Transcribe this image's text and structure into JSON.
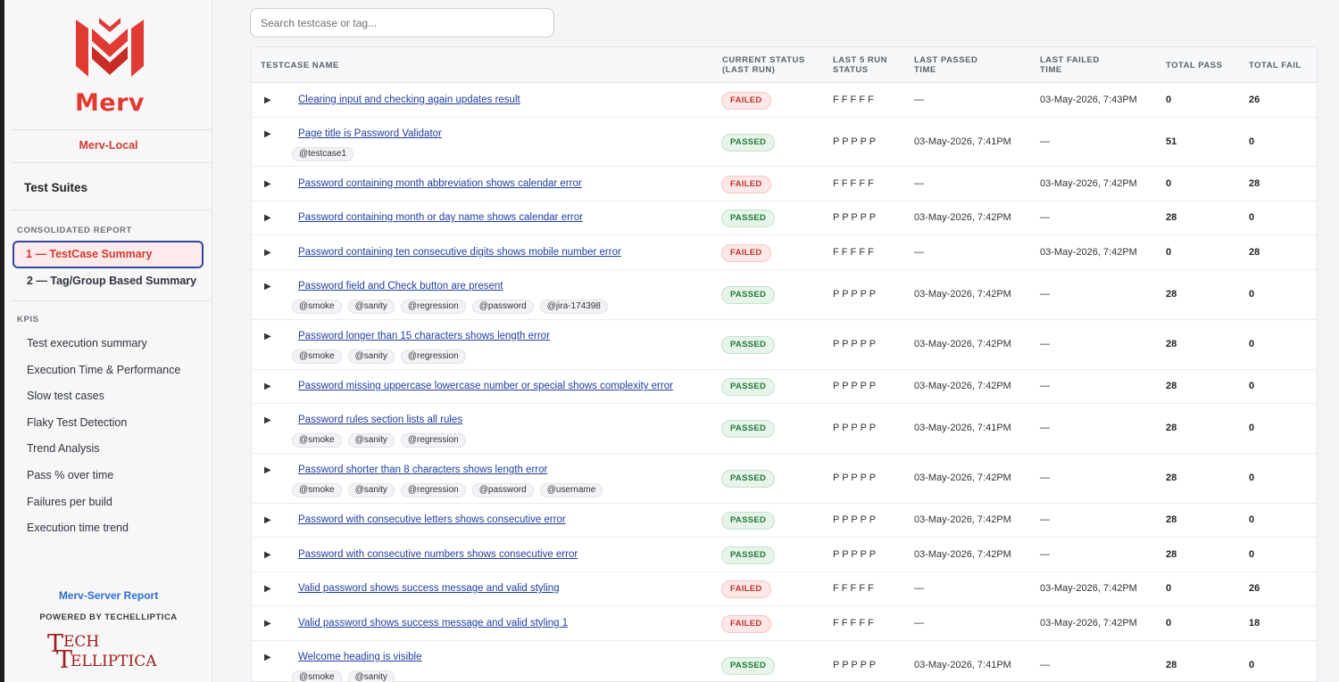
{
  "brand": {
    "logo_text": "Merv",
    "environment": "Merv-Local",
    "server_link": "Merv-Server Report",
    "powered_by": "POWERED BY TECHELLIPTICA",
    "partner_logo_line1": "ECH",
    "partner_logo_line2": "ELLIPTICA",
    "accent_color": "#e03a32"
  },
  "sidebar": {
    "suites_label": "Test Suites",
    "consolidated_label": "CONSOLIDATED REPORT",
    "consolidated_items": [
      {
        "label": "1 — TestCase Summary",
        "active": true
      },
      {
        "label": "2 — Tag/Group Based Summary",
        "active": false
      }
    ],
    "kpis_label": "KPIS",
    "kpi_items": [
      {
        "label": "Test execution summary"
      },
      {
        "label": "Execution Time & Performance"
      },
      {
        "label": "Slow test cases"
      },
      {
        "label": "Flaky Test Detection"
      },
      {
        "label": "Trend Analysis"
      },
      {
        "label": "Pass % over time"
      },
      {
        "label": "Failures per build"
      },
      {
        "label": "Execution time trend"
      }
    ]
  },
  "search": {
    "placeholder": "Search testcase or tag..."
  },
  "table": {
    "headers": {
      "name": "TESTCASE NAME",
      "status_1": "CURRENT STATUS",
      "status_2": "(LAST RUN)",
      "last5_1": "LAST 5 RUN",
      "last5_2": "STATUS",
      "passed_1": "LAST PASSED",
      "passed_2": "TIME",
      "failed_1": "LAST FAILED",
      "failed_2": "TIME",
      "total_pass": "TOTAL PASS",
      "total_fail": "TOTAL FAIL"
    },
    "rows": [
      {
        "name": "Clearing input and checking again updates result",
        "tags": [],
        "status": "FAILED",
        "last5": "F F F F F",
        "last_passed": "—",
        "last_failed": "03-May-2026, 7:43PM",
        "total_pass": "0",
        "total_fail": "26"
      },
      {
        "name": "Page title is Password Validator",
        "tags": [
          "@testcase1"
        ],
        "status": "PASSED",
        "last5": "P P P P P",
        "last_passed": "03-May-2026, 7:41PM",
        "last_failed": "—",
        "total_pass": "51",
        "total_fail": "0"
      },
      {
        "name": "Password containing month abbreviation shows calendar error",
        "tags": [],
        "status": "FAILED",
        "last5": "F F F F F",
        "last_passed": "—",
        "last_failed": "03-May-2026, 7:42PM",
        "total_pass": "0",
        "total_fail": "28"
      },
      {
        "name": "Password containing month or day name shows calendar error",
        "tags": [],
        "status": "PASSED",
        "last5": "P P P P P",
        "last_passed": "03-May-2026, 7:42PM",
        "last_failed": "—",
        "total_pass": "28",
        "total_fail": "0"
      },
      {
        "name": "Password containing ten consecutive digits shows mobile number error",
        "tags": [],
        "status": "FAILED",
        "last5": "F F F F F",
        "last_passed": "—",
        "last_failed": "03-May-2026, 7:42PM",
        "total_pass": "0",
        "total_fail": "28"
      },
      {
        "name": "Password field and Check button are present",
        "tags": [
          "@smoke",
          "@sanity",
          "@regression",
          "@password",
          "@jira-174398"
        ],
        "status": "PASSED",
        "last5": "P P P P P",
        "last_passed": "03-May-2026, 7:42PM",
        "last_failed": "—",
        "total_pass": "28",
        "total_fail": "0"
      },
      {
        "name": "Password longer than 15 characters shows length error",
        "tags": [
          "@smoke",
          "@sanity",
          "@regression"
        ],
        "status": "PASSED",
        "last5": "P P P P P",
        "last_passed": "03-May-2026, 7:42PM",
        "last_failed": "—",
        "total_pass": "28",
        "total_fail": "0"
      },
      {
        "name": "Password missing uppercase lowercase number or special shows complexity error",
        "tags": [],
        "status": "PASSED",
        "last5": "P P P P P",
        "last_passed": "03-May-2026, 7:42PM",
        "last_failed": "—",
        "total_pass": "28",
        "total_fail": "0"
      },
      {
        "name": "Password rules section lists all rules",
        "tags": [
          "@smoke",
          "@sanity",
          "@regression"
        ],
        "status": "PASSED",
        "last5": "P P P P P",
        "last_passed": "03-May-2026, 7:41PM",
        "last_failed": "—",
        "total_pass": "28",
        "total_fail": "0"
      },
      {
        "name": "Password shorter than 8 characters shows length error",
        "tags": [
          "@smoke",
          "@sanity",
          "@regression",
          "@password",
          "@username"
        ],
        "status": "PASSED",
        "last5": "P P P P P",
        "last_passed": "03-May-2026, 7:42PM",
        "last_failed": "—",
        "total_pass": "28",
        "total_fail": "0"
      },
      {
        "name": "Password with consecutive letters shows consecutive error",
        "tags": [],
        "status": "PASSED",
        "last5": "P P P P P",
        "last_passed": "03-May-2026, 7:42PM",
        "last_failed": "—",
        "total_pass": "28",
        "total_fail": "0"
      },
      {
        "name": "Password with consecutive numbers shows consecutive error",
        "tags": [],
        "status": "PASSED",
        "last5": "P P P P P",
        "last_passed": "03-May-2026, 7:42PM",
        "last_failed": "—",
        "total_pass": "28",
        "total_fail": "0"
      },
      {
        "name": "Valid password shows success message and valid styling",
        "tags": [],
        "status": "FAILED",
        "last5": "F F F F F",
        "last_passed": "—",
        "last_failed": "03-May-2026, 7:42PM",
        "total_pass": "0",
        "total_fail": "26"
      },
      {
        "name": "Valid password shows success message and valid styling 1",
        "tags": [],
        "status": "FAILED",
        "last5": "F F F F F",
        "last_passed": "—",
        "last_failed": "03-May-2026, 7:42PM",
        "total_pass": "0",
        "total_fail": "18"
      },
      {
        "name": "Welcome heading is visible",
        "tags": [
          "@smoke",
          "@sanity"
        ],
        "status": "PASSED",
        "last5": "P P P P P",
        "last_passed": "03-May-2026, 7:41PM",
        "last_failed": "—",
        "total_pass": "28",
        "total_fail": "0"
      }
    ]
  }
}
